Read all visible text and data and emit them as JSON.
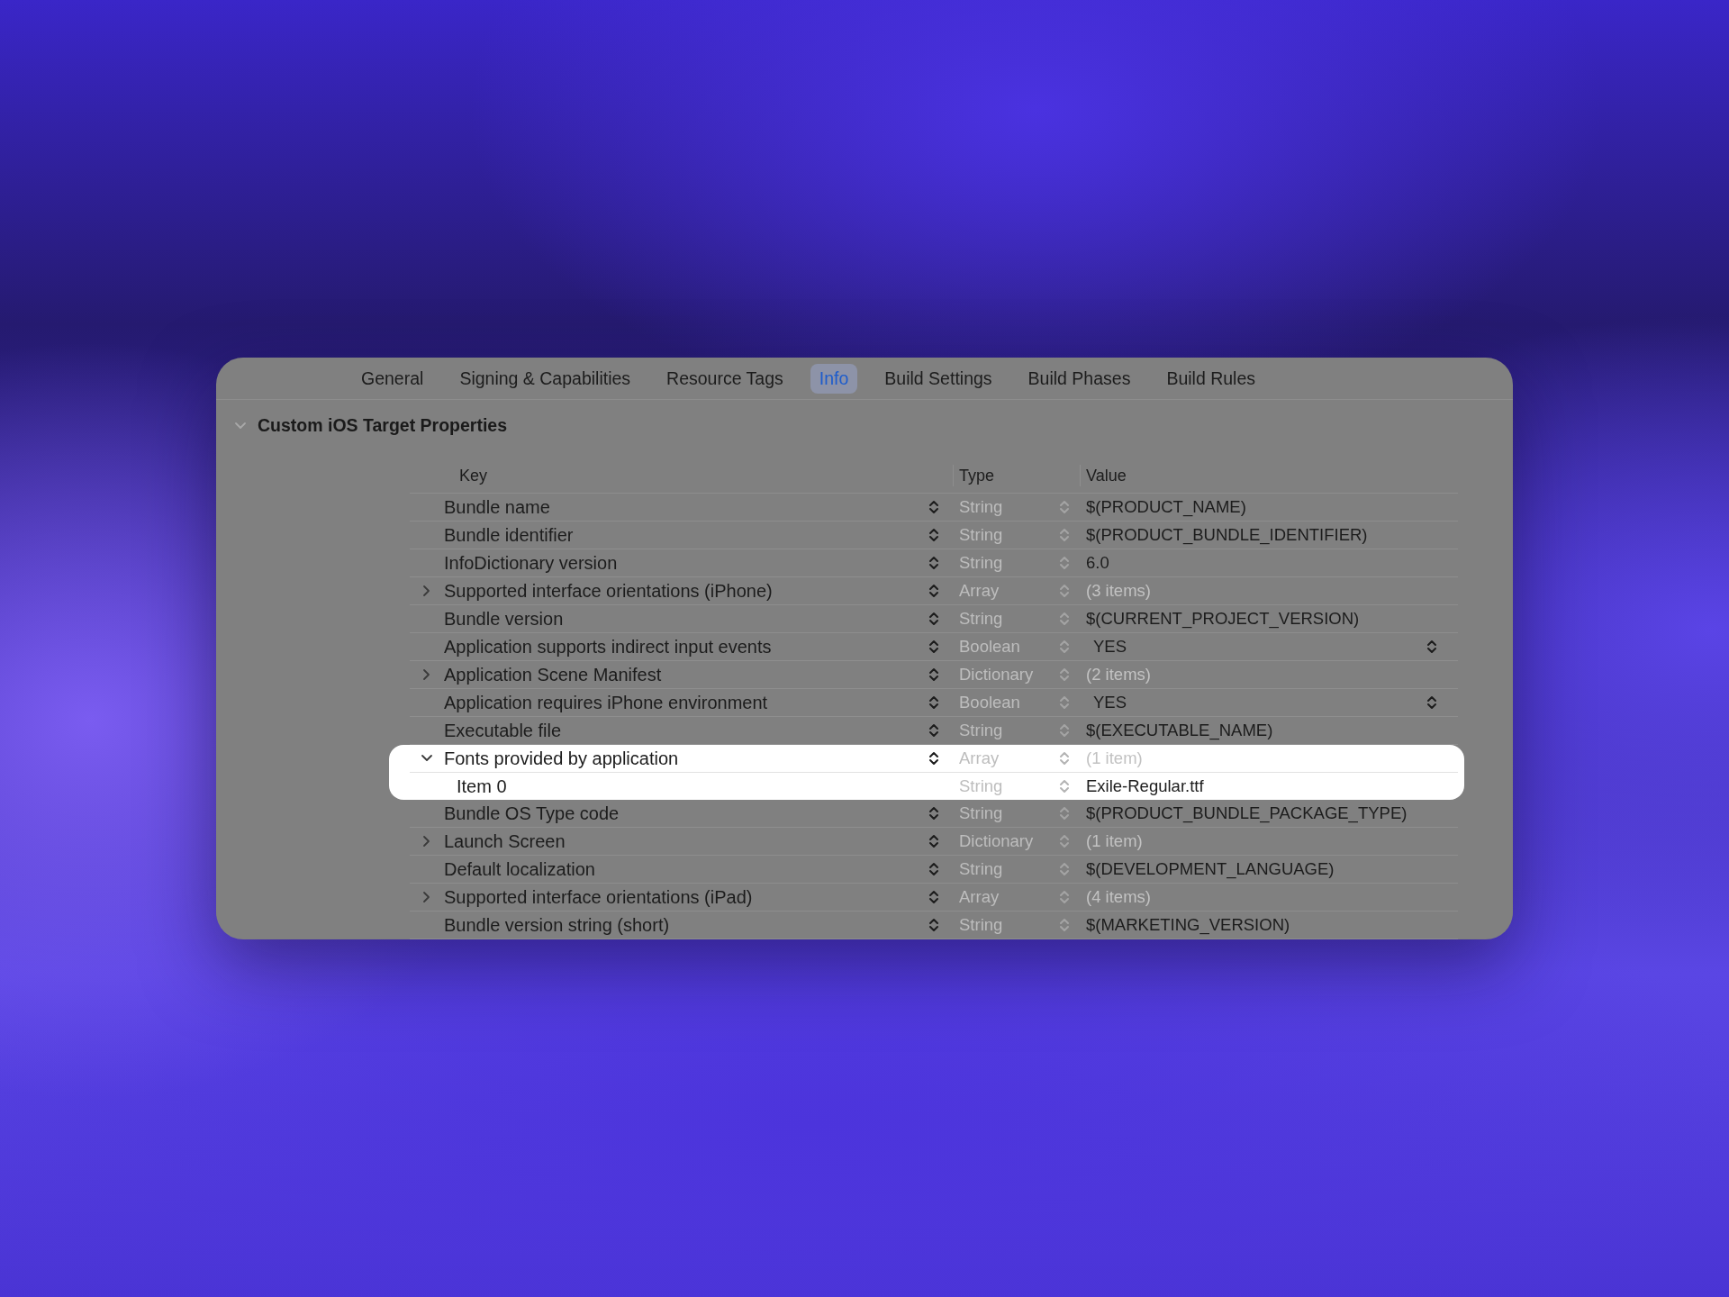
{
  "tabs": [
    {
      "label": "General",
      "selected": false
    },
    {
      "label": "Signing & Capabilities",
      "selected": false
    },
    {
      "label": "Resource Tags",
      "selected": false
    },
    {
      "label": "Info",
      "selected": true
    },
    {
      "label": "Build Settings",
      "selected": false
    },
    {
      "label": "Build Phases",
      "selected": false
    },
    {
      "label": "Build Rules",
      "selected": false
    }
  ],
  "section": {
    "title": "Custom iOS Target Properties",
    "expanded": true
  },
  "table": {
    "columns": [
      "Key",
      "Type",
      "Value"
    ],
    "rows": [
      {
        "key": "Bundle name",
        "type": "String",
        "value": "$(PRODUCT_NAME)",
        "kind": "text",
        "highlighted": false
      },
      {
        "key": "Bundle identifier",
        "type": "String",
        "value": "$(PRODUCT_BUNDLE_IDENTIFIER)",
        "kind": "text",
        "highlighted": false
      },
      {
        "key": "InfoDictionary version",
        "type": "String",
        "value": "6.0",
        "kind": "text",
        "highlighted": false
      },
      {
        "key": "Supported interface orientations (iPhone)",
        "expanded": false,
        "type": "Array",
        "value": "(3 items)",
        "kind": "count",
        "highlighted": false
      },
      {
        "key": "Bundle version",
        "type": "String",
        "value": "$(CURRENT_PROJECT_VERSION)",
        "kind": "text",
        "highlighted": false
      },
      {
        "key": "Application supports indirect input events",
        "type": "Boolean",
        "value": "YES",
        "kind": "popup",
        "highlighted": false
      },
      {
        "key": "Application Scene Manifest",
        "expanded": false,
        "type": "Dictionary",
        "value": "(2 items)",
        "kind": "count",
        "highlighted": false
      },
      {
        "key": "Application requires iPhone environment",
        "type": "Boolean",
        "value": "YES",
        "kind": "popup",
        "highlighted": false
      },
      {
        "key": "Executable file",
        "type": "String",
        "value": "$(EXECUTABLE_NAME)",
        "kind": "text",
        "highlighted": false
      },
      {
        "key": "Fonts provided by application",
        "expanded": true,
        "type": "Array",
        "value": "(1 item)",
        "kind": "count",
        "highlighted": true,
        "children": [
          {
            "key": "Item 0",
            "type": "String",
            "value": "Exile-Regular.ttf",
            "kind": "text"
          }
        ]
      },
      {
        "key": "Bundle OS Type code",
        "type": "String",
        "value": "$(PRODUCT_BUNDLE_PACKAGE_TYPE)",
        "kind": "text",
        "highlighted": false
      },
      {
        "key": "Launch Screen",
        "expanded": false,
        "type": "Dictionary",
        "value": "(1 item)",
        "kind": "count",
        "highlighted": false
      },
      {
        "key": "Default localization",
        "type": "String",
        "value": "$(DEVELOPMENT_LANGUAGE)",
        "kind": "text",
        "highlighted": false
      },
      {
        "key": "Supported interface orientations (iPad)",
        "expanded": false,
        "type": "Array",
        "value": "(4 items)",
        "kind": "count",
        "highlighted": false
      },
      {
        "key": "Bundle version string (short)",
        "type": "String",
        "value": "$(MARKETING_VERSION)",
        "kind": "text",
        "highlighted": false
      }
    ]
  }
}
